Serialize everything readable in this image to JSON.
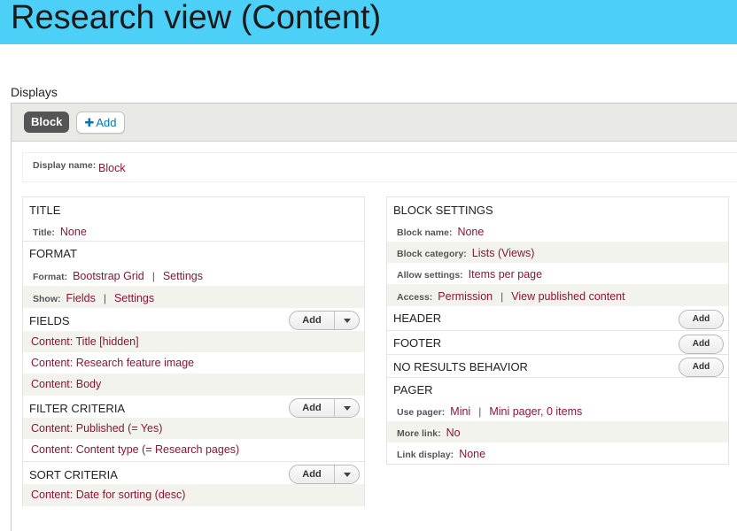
{
  "page": {
    "title": "Research view (Content)"
  },
  "displays": {
    "label": "Displays",
    "tabs": [
      {
        "label": "Block",
        "active": true
      }
    ],
    "add_tab": {
      "icon": "plus-icon",
      "label": "Add"
    }
  },
  "display_name": {
    "label": "Display name:",
    "value": "Block"
  },
  "left": {
    "title": {
      "heading": "TITLE",
      "label": "Title:",
      "value": "None"
    },
    "format": {
      "heading": "FORMAT",
      "format_label": "Format:",
      "format_value": "Bootstrap Grid",
      "format_settings": "Settings",
      "show_label": "Show:",
      "show_value": "Fields",
      "show_settings": "Settings"
    },
    "fields": {
      "heading": "FIELDS",
      "button": "Add",
      "items": [
        "Content: Title [hidden]",
        "Content: Research feature image",
        "Content: Body"
      ]
    },
    "filter": {
      "heading": "FILTER CRITERIA",
      "button": "Add",
      "items": [
        "Content: Published (= Yes)",
        "Content: Content type (= Research pages)"
      ]
    },
    "sort": {
      "heading": "SORT CRITERIA",
      "button": "Add",
      "items": [
        "Content: Date for sorting (desc)"
      ]
    }
  },
  "right": {
    "block_settings": {
      "heading": "BLOCK SETTINGS",
      "block_name_label": "Block name:",
      "block_name_value": "None",
      "block_category_label": "Block category:",
      "block_category_value": "Lists (Views)",
      "allow_settings_label": "Allow settings:",
      "allow_settings_value": "Items per page",
      "access_label": "Access:",
      "access_value": "Permission",
      "access_detail": "View published content"
    },
    "header": {
      "heading": "HEADER",
      "button": "Add"
    },
    "footer": {
      "heading": "FOOTER",
      "button": "Add"
    },
    "no_results": {
      "heading": "NO RESULTS BEHAVIOR",
      "button": "Add"
    },
    "pager": {
      "heading": "PAGER",
      "use_pager_label": "Use pager:",
      "use_pager_value": "Mini",
      "use_pager_detail": "Mini pager, 0 items",
      "more_link_label": "More link:",
      "more_link_value": "No",
      "link_display_label": "Link display:",
      "link_display_value": "None"
    }
  },
  "colors": {
    "header_bg": "#4cd0f8",
    "link": "#8a1538",
    "add_link": "#0074bd",
    "active_tab_bg": "#555555",
    "alt_row_bg": "#f3f3ed"
  }
}
